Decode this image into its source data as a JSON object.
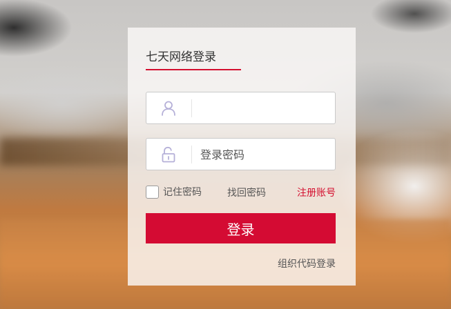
{
  "login": {
    "tab_label": "七天网络登录",
    "username": {
      "value": "",
      "placeholder": ""
    },
    "password": {
      "value": "",
      "placeholder": "登录密码"
    },
    "remember_label": "记住密码",
    "remember_checked": false,
    "forgot_label": "找回密码",
    "register_label": "注册账号",
    "submit_label": "登录",
    "org_login_label": "组织代码登录"
  },
  "icons": {
    "username": "user-icon",
    "password": "lock-icon"
  },
  "colors": {
    "accent": "#d40b33",
    "icon": "#b5b0d8"
  }
}
